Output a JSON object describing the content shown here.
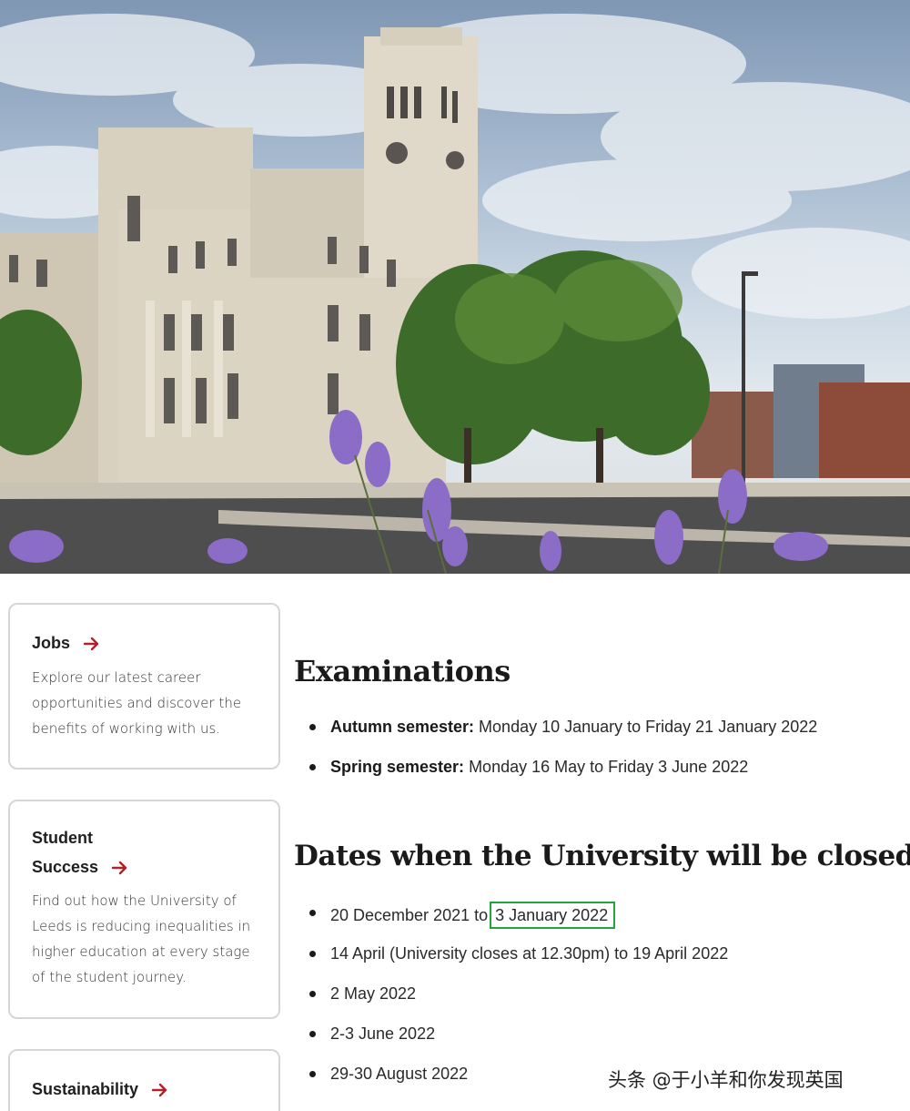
{
  "hero": {
    "image_description_icon": "university-clock-tower-photo"
  },
  "cards": {
    "jobs": {
      "title": "Jobs",
      "description": "Explore our latest career opportunities and discover the benefits of working with us."
    },
    "student_success": {
      "title_line1": "Student",
      "title_line2": "Success",
      "description": "Find out how the University of Leeds is reducing inequalities in higher education at every stage of the student journey."
    },
    "sustainability": {
      "title": "Sustainability"
    }
  },
  "examinations": {
    "heading": "Examinations",
    "items": [
      {
        "label": "Autumn semester:",
        "value": " Monday 10 January to Friday 21 January 2022"
      },
      {
        "label": "Spring semester:",
        "value": " Monday 16 May to Friday 3 June 2022"
      }
    ]
  },
  "closures": {
    "heading": "Dates when the University will be closed",
    "items": [
      {
        "text_before": "20 December 2021 to",
        "text_highlight": "3 January 2022"
      },
      {
        "text": "14 April (University closes at 12.30pm) to 19 April 2022"
      },
      {
        "text": "2 May 2022"
      },
      {
        "text": "2-3 June 2022"
      },
      {
        "text": "29-30 August 2022"
      }
    ]
  },
  "watermark": "头条 @于小羊和你发现英国",
  "colors": {
    "accent_arrow": "#b1212a",
    "highlight_border": "#23a33b",
    "card_border": "#d6d6d6"
  }
}
